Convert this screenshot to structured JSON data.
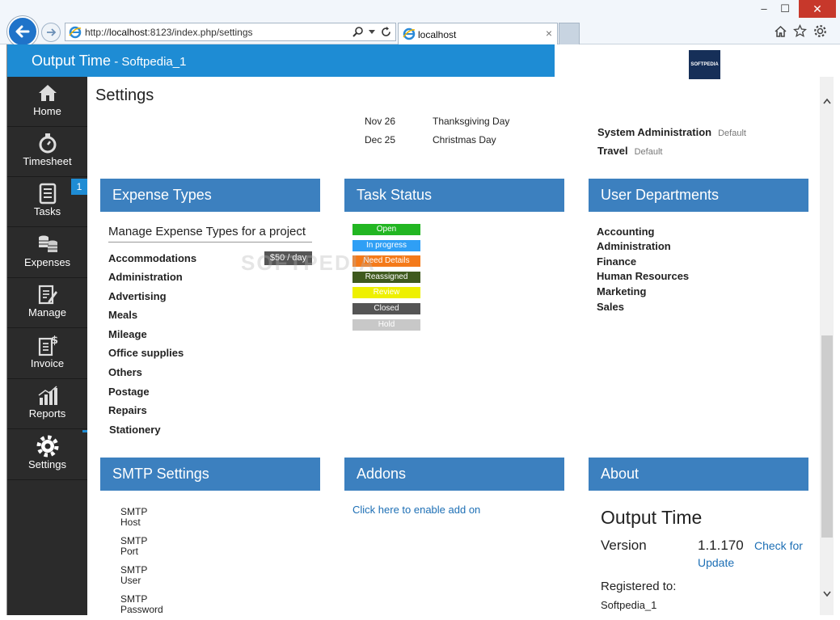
{
  "browser": {
    "url_prefix": "http://",
    "url_host": "localhost",
    "url_rest": ":8123/index.php/settings",
    "tab_title": "localhost",
    "tab_close": "×"
  },
  "window": {
    "minimize": "–",
    "maximize": "☐",
    "close": "✕"
  },
  "header": {
    "app_title": "Output Time",
    "app_subtitle": " - Softpedia_1",
    "logo_text": "SOFTPEDIA"
  },
  "sidebar": {
    "items": [
      {
        "label": "Home",
        "icon": "home-icon"
      },
      {
        "label": "Timesheet",
        "icon": "stopwatch-icon"
      },
      {
        "label": "Tasks",
        "icon": "tasks-icon",
        "badge": "1"
      },
      {
        "label": "Expenses",
        "icon": "coins-icon"
      },
      {
        "label": "Manage",
        "icon": "manage-icon"
      },
      {
        "label": "Invoice",
        "icon": "invoice-icon"
      },
      {
        "label": "Reports",
        "icon": "reports-icon"
      },
      {
        "label": "Settings",
        "icon": "gear-icon"
      }
    ]
  },
  "page": {
    "title": "Settings"
  },
  "holidays": [
    {
      "date": "Nov 26",
      "name": "Thanksgiving Day"
    },
    {
      "date": "Dec 25",
      "name": "Christmas Day"
    }
  ],
  "top_departments": [
    {
      "name": "System Administration",
      "tag": "Default"
    },
    {
      "name": "Travel",
      "tag": "Default"
    }
  ],
  "expense_types": {
    "heading": "Expense Types",
    "subheading": "Manage Expense Types for a project",
    "rate": "$50 / day",
    "items": [
      "Accommodations",
      "Administration",
      "Advertising",
      "Meals",
      "Mileage",
      "Office supplies",
      "Others",
      "Postage",
      "Repairs",
      "Stationery"
    ]
  },
  "task_status": {
    "heading": "Task Status",
    "items": [
      {
        "label": "Open",
        "color": "#22b622"
      },
      {
        "label": "In progress",
        "color": "#2f9ff5"
      },
      {
        "label": "Need Details",
        "color": "#f47a1a"
      },
      {
        "label": "Reassigned",
        "color": "#3f5a1e"
      },
      {
        "label": "Review",
        "color": "#eef000"
      },
      {
        "label": "Closed",
        "color": "#555555"
      },
      {
        "label": "Hold",
        "color": "#c8c8c8"
      }
    ]
  },
  "user_departments": {
    "heading": "User Departments",
    "items": [
      "Accounting",
      "Administration",
      "Finance",
      "Human Resources",
      "Marketing",
      "Sales"
    ]
  },
  "smtp": {
    "heading": "SMTP Settings",
    "fields": [
      {
        "line1": "SMTP",
        "line2": "Host"
      },
      {
        "line1": "SMTP",
        "line2": "Port"
      },
      {
        "line1": "SMTP",
        "line2": "User"
      },
      {
        "line1": "SMTP",
        "line2": "Password"
      }
    ]
  },
  "addons": {
    "heading": "Addons",
    "link": "Click here to enable add on"
  },
  "about": {
    "heading": "About",
    "product": "Output Time",
    "version_label": "Version",
    "version": "1.1.170",
    "check_update": "Check for Update",
    "registered_label": "Registered to:",
    "registered_user": "Softpedia_1"
  },
  "watermark": "SOFTPEDIA"
}
